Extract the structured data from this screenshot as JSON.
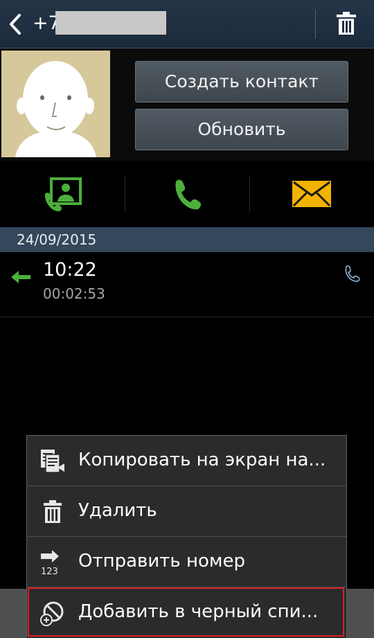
{
  "action_bar": {
    "title": "+7",
    "back_icon": "back-chevron-icon",
    "delete_icon": "trash-icon"
  },
  "contact": {
    "avatar_icon": "default-avatar-face-icon",
    "create_contact_label": "Создать контакт",
    "update_label": "Обновить"
  },
  "quick_actions": [
    {
      "icon": "contact-call-icon",
      "color": "#4caf3b"
    },
    {
      "icon": "phone-icon",
      "color": "#4caf3b"
    },
    {
      "icon": "envelope-icon",
      "color": "#f2b300"
    }
  ],
  "log": {
    "date": "24/09/2015",
    "entries": [
      {
        "time": "10:22",
        "duration": "00:02:53",
        "direction_icon": "incoming-arrow-icon",
        "type_icon": "phone-icon"
      }
    ]
  },
  "menu": {
    "items": [
      {
        "label": "Копировать на экран на...",
        "icon": "copy-to-screen-icon"
      },
      {
        "label": "Удалить",
        "icon": "trash-icon"
      },
      {
        "label": "Отправить номер",
        "icon": "send-number-icon"
      },
      {
        "label": "Добавить в черный спи...",
        "icon": "block-add-icon"
      }
    ]
  },
  "colors": {
    "action_bar": "#1f2f42",
    "date_header": "#34475b",
    "accent_green": "#4caf3b",
    "highlight_red": "#e02020"
  }
}
